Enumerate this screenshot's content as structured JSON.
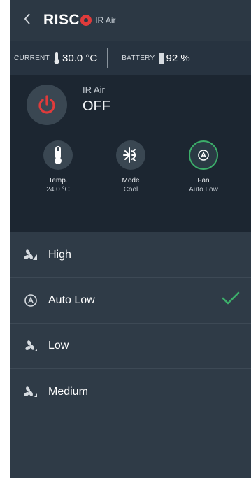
{
  "header": {
    "back_icon": "chevron-left-icon",
    "brand": "RISC",
    "device_name": "IR Air"
  },
  "status": {
    "current_label": "CURRENT",
    "current_value": "30.0 °C",
    "battery_label": "BATTERY",
    "battery_value": "92 %"
  },
  "device": {
    "title": "IR Air",
    "state": "OFF",
    "power_color": "#e03b3b"
  },
  "controls": [
    {
      "label": "Temp.",
      "value": "24.0 °C",
      "icon": "thermometer-icon"
    },
    {
      "label": "Mode",
      "value": "Cool",
      "icon": "snowflake-sun-icon"
    },
    {
      "label": "Fan",
      "value": "Auto Low",
      "icon": "fan-auto-icon"
    }
  ],
  "fan_options": [
    {
      "label": "High",
      "icon": "fan-high-icon",
      "selected": false
    },
    {
      "label": "Auto Low",
      "icon": "fan-auto-icon",
      "selected": true
    },
    {
      "label": "Low",
      "icon": "fan-low-icon",
      "selected": false
    },
    {
      "label": "Medium",
      "icon": "fan-medium-icon",
      "selected": false
    }
  ],
  "colors": {
    "accent_green": "#3cae6a",
    "brand_red": "#e03b3b",
    "background": "#2f3b47"
  }
}
